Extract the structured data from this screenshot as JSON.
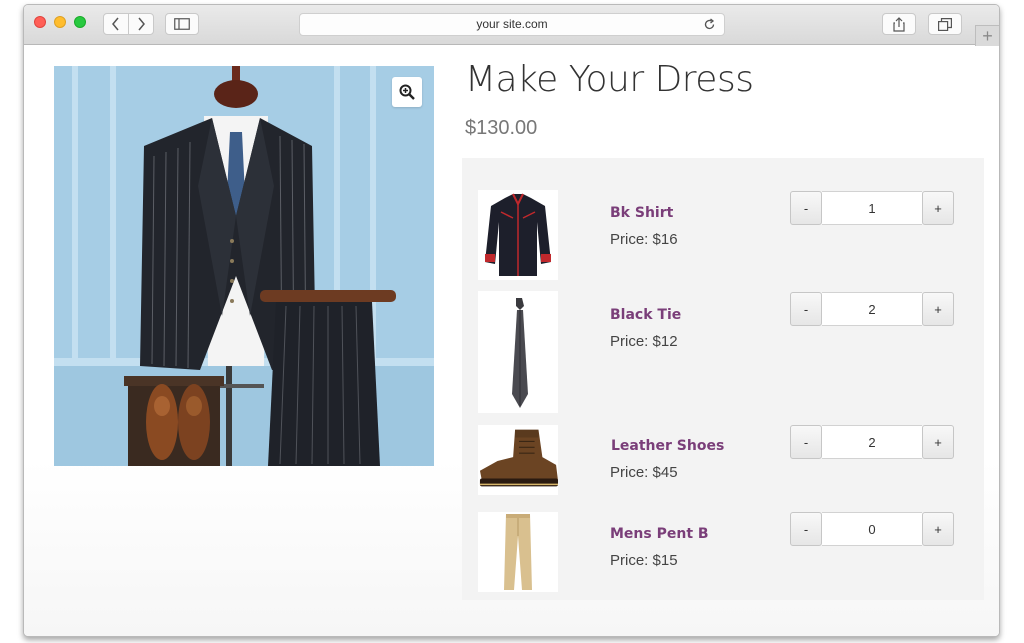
{
  "browser": {
    "address": "your site.com",
    "icons": {
      "back": "chevron-left-icon",
      "forward": "chevron-right-icon",
      "sidebar": "sidebar-icon",
      "reload": "reload-icon",
      "share": "share-icon",
      "tabs": "tabs-icon",
      "new_tab": "plus-icon"
    },
    "colors": {
      "close": "#ff5f57",
      "minimize": "#ffbd2e",
      "maximize": "#28c940"
    }
  },
  "product": {
    "title": "Make Your Dress",
    "price": "$130.00",
    "zoom_icon": "zoom-in-icon"
  },
  "addons": [
    {
      "name": "Bk Shirt",
      "price": "Price: $16",
      "quantity": "1",
      "minus": "-",
      "plus": "+",
      "thumb_icon": "shirt-image"
    },
    {
      "name": "Black Tie",
      "price": "Price: $12",
      "quantity": "2",
      "minus": "-",
      "plus": "+",
      "thumb_icon": "tie-image"
    },
    {
      "name": "Leather Shoes",
      "price": "Price: $45",
      "quantity": "2",
      "minus": "-",
      "plus": "+",
      "thumb_icon": "boot-image"
    },
    {
      "name": "Mens Pent B",
      "price": "Price: $15",
      "quantity": "0",
      "minus": "-",
      "plus": "+",
      "thumb_icon": "pants-image"
    }
  ],
  "theme": {
    "addon_name_color": "#7a3e79",
    "panel_background": "#f3f3f3"
  }
}
